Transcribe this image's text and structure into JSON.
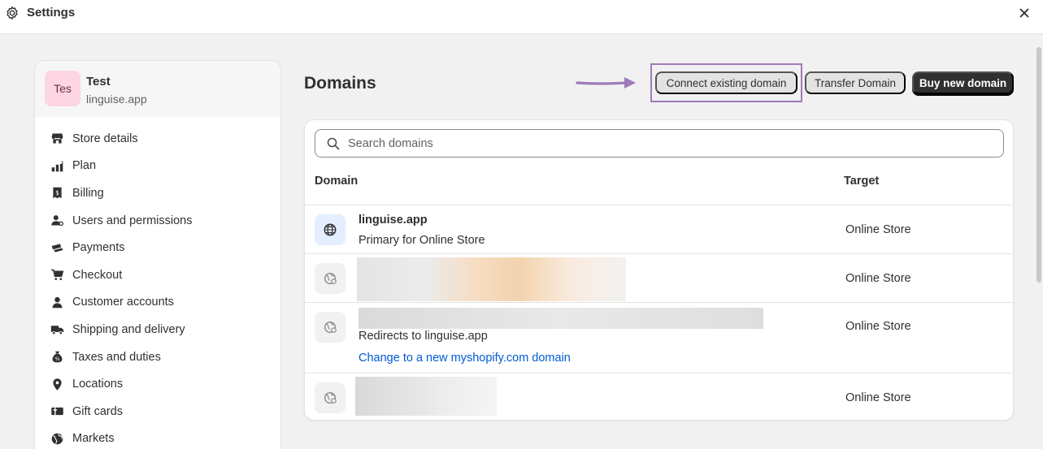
{
  "window": {
    "title": "Settings",
    "icons": {
      "settings": "gear-icon",
      "close": "close-icon"
    }
  },
  "store": {
    "avatar_text": "Tes",
    "name": "Test",
    "domain": "linguise.app"
  },
  "sidebar": {
    "items": [
      {
        "label": "Store details",
        "icon": "store-icon"
      },
      {
        "label": "Plan",
        "icon": "plan-icon"
      },
      {
        "label": "Billing",
        "icon": "billing-icon"
      },
      {
        "label": "Users and permissions",
        "icon": "users-icon"
      },
      {
        "label": "Payments",
        "icon": "payments-icon"
      },
      {
        "label": "Checkout",
        "icon": "cart-icon"
      },
      {
        "label": "Customer accounts",
        "icon": "person-icon"
      },
      {
        "label": "Shipping and delivery",
        "icon": "truck-icon"
      },
      {
        "label": "Taxes and duties",
        "icon": "tax-icon"
      },
      {
        "label": "Locations",
        "icon": "location-icon"
      },
      {
        "label": "Gift cards",
        "icon": "gift-card-icon"
      },
      {
        "label": "Markets",
        "icon": "globe-icon"
      }
    ]
  },
  "main": {
    "title": "Domains",
    "actions": {
      "connect_label": "Connect existing domain",
      "transfer_label": "Transfer Domain",
      "buy_label": "Buy new domain"
    },
    "search": {
      "placeholder": "Search domains",
      "value": ""
    },
    "table": {
      "columns": [
        "Domain",
        "Target"
      ],
      "rows": [
        {
          "name": "linguise.app",
          "subtitle": "Primary for Online Store",
          "target": "Online Store",
          "icon": "globe-icon",
          "redacted": false
        },
        {
          "name": "",
          "subtitle": "",
          "target": "Online Store",
          "icon": "globe-connected-icon",
          "redacted": true
        },
        {
          "name": "",
          "subtitle": "Redirects to linguise.app",
          "link": "Change to a new myshopify.com domain",
          "target": "Online Store",
          "icon": "globe-connected-icon",
          "redacted": true
        },
        {
          "name": "",
          "subtitle": "",
          "target": "Online Store",
          "icon": "globe-connected-icon",
          "redacted": true
        }
      ]
    }
  },
  "annotation": {
    "highlight_color": "#9d7bb8",
    "arrow_color": "#9d7bb8"
  },
  "colors": {
    "accent_dark": "#303030",
    "link": "#005bd3",
    "avatar_bg": "#fdd5e3",
    "primary_icon_bg": "#e3efff"
  }
}
